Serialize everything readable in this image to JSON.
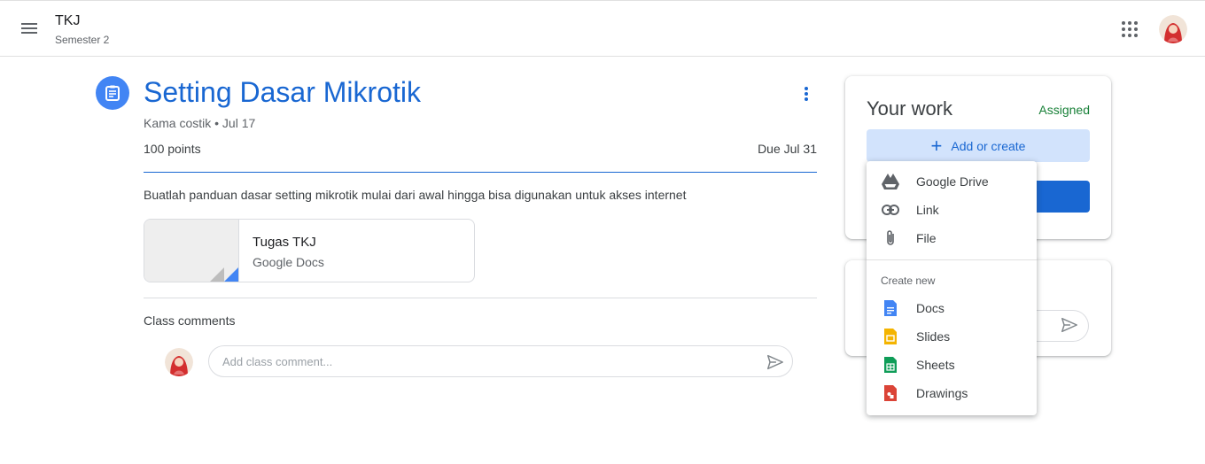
{
  "header": {
    "class_name": "TKJ",
    "class_section": "Semester 2"
  },
  "assignment": {
    "title": "Setting Dasar Mikrotik",
    "meta": "Kama costik • Jul 17",
    "points": "100 points",
    "due": "Due Jul 31",
    "description": "Buatlah panduan dasar setting mikrotik mulai dari awal hingga bisa digunakan untuk akses internet",
    "attachment": {
      "title": "Tugas TKJ",
      "type": "Google Docs"
    }
  },
  "comments": {
    "label": "Class comments",
    "placeholder": "Add class comment..."
  },
  "your_work": {
    "title": "Your work",
    "status": "Assigned",
    "add_label": "Add or create"
  },
  "dropdown": {
    "items": [
      {
        "label": "Google Drive",
        "icon": "google-drive-icon"
      },
      {
        "label": "Link",
        "icon": "link-icon"
      },
      {
        "label": "File",
        "icon": "paperclip-icon"
      }
    ],
    "create_label": "Create new",
    "create_items": [
      {
        "label": "Docs",
        "icon": "docs-icon",
        "color": "#4285f4"
      },
      {
        "label": "Slides",
        "icon": "slides-icon",
        "color": "#f4b400"
      },
      {
        "label": "Sheets",
        "icon": "sheets-icon",
        "color": "#0f9d58"
      },
      {
        "label": "Drawings",
        "icon": "drawings-icon",
        "color": "#db4437"
      }
    ]
  },
  "colors": {
    "accent": "#1967d2",
    "assigned": "#188038",
    "add_button_bg": "#d2e3fc"
  }
}
